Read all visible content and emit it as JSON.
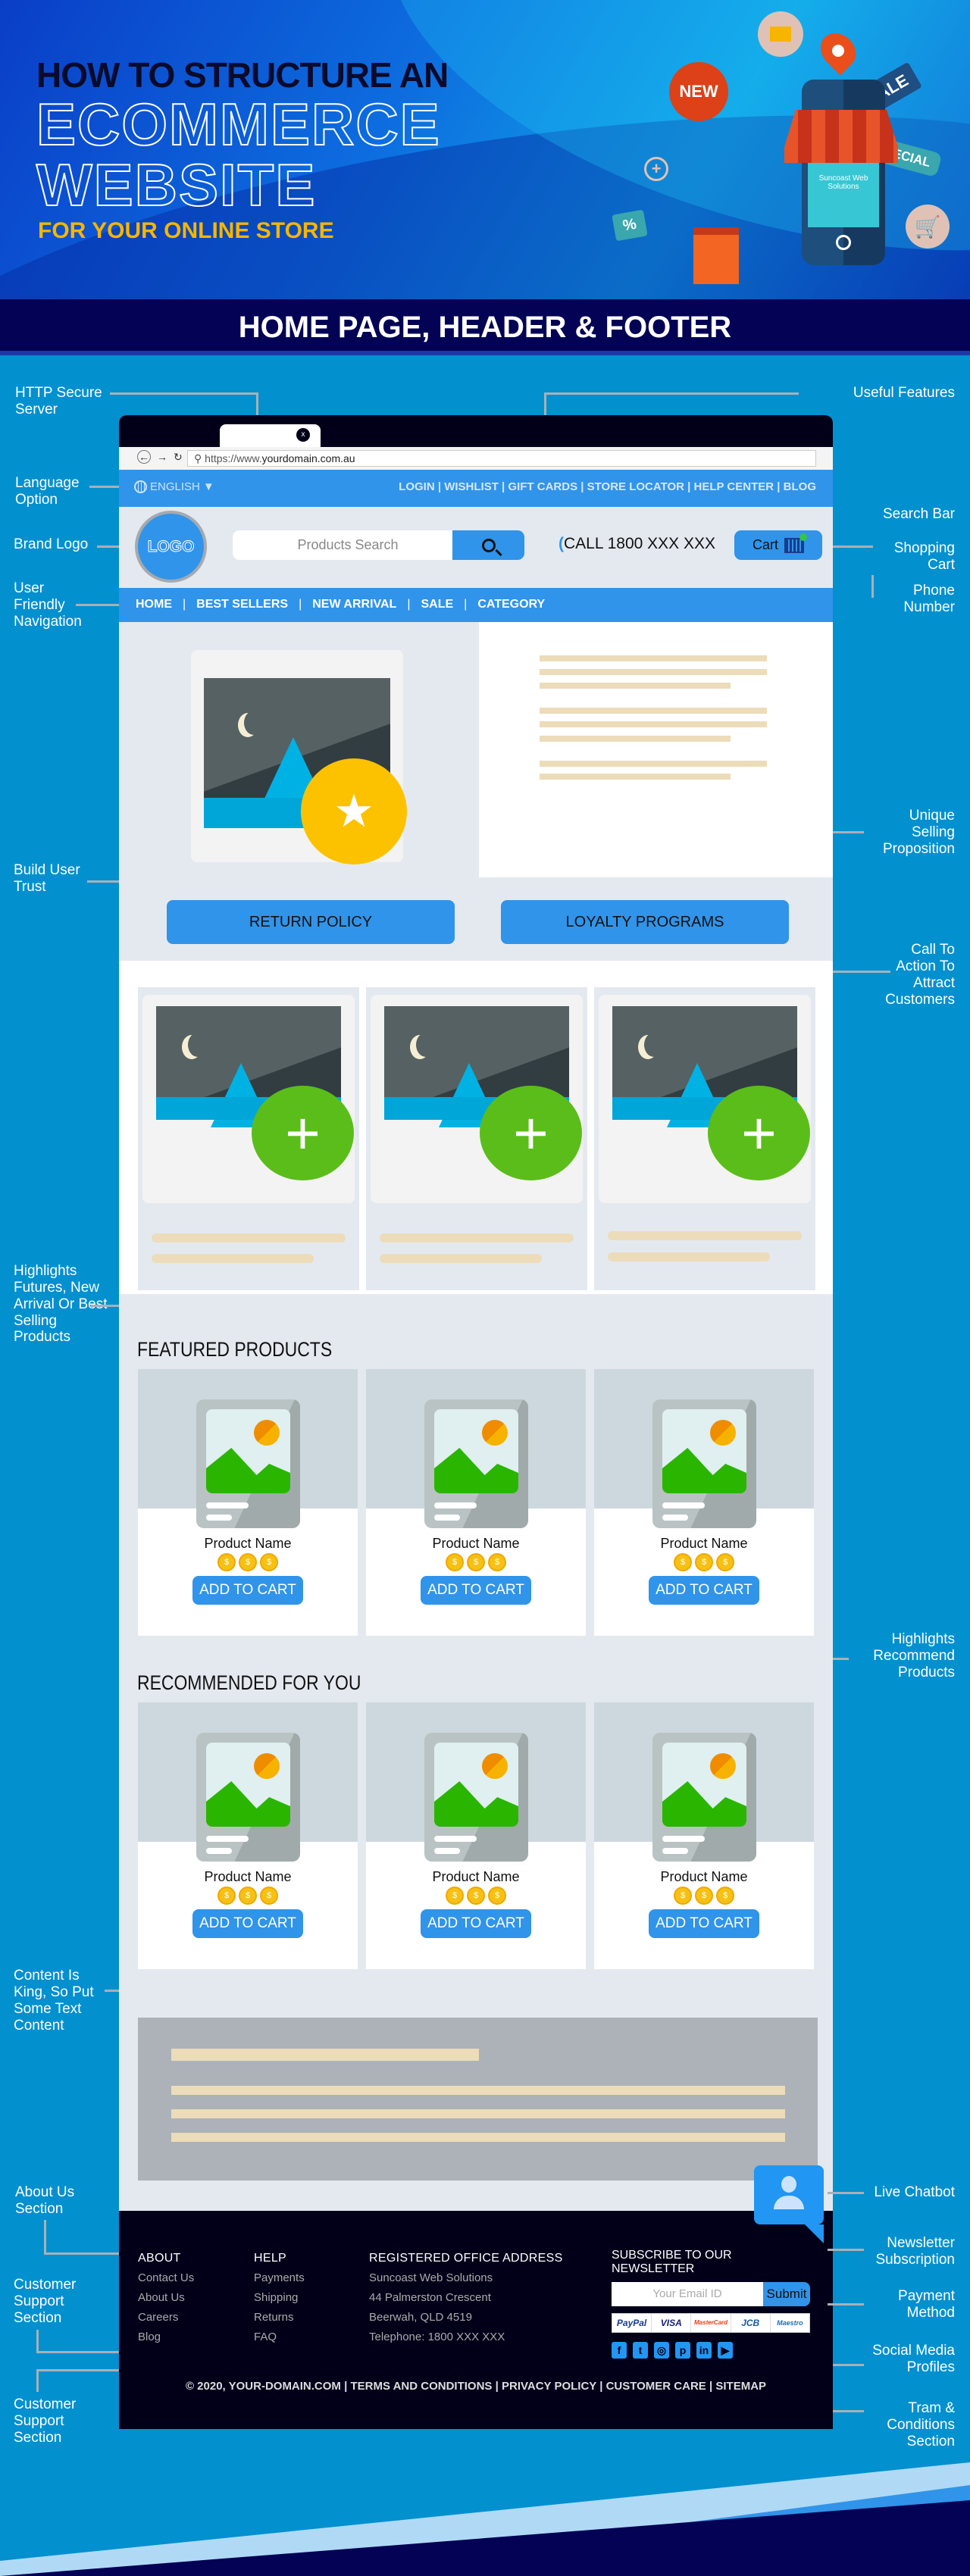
{
  "hero": {
    "line1": "HOW TO STRUCTURE AN",
    "line2": "ECOMMERCE",
    "line3": "WEBSITE",
    "line4": "FOR YOUR ONLINE STORE",
    "badges": {
      "new": "NEW",
      "sale": "SALE",
      "special": "SPECIAL",
      "percent": "%"
    },
    "phone_brand": "Suncoast Web Solutions"
  },
  "section_title": "HOME PAGE, HEADER & FOOTER",
  "annotations": {
    "http": "HTTP Secure Server",
    "useful": "Useful Features",
    "language": "Language Option",
    "search_bar": "Search Bar",
    "brand_logo": "Brand Logo",
    "shopping_cart": "Shopping Cart",
    "user_nav": "User Friendly Navigation",
    "phone": "Phone Number",
    "usp": "Unique Selling Proposition",
    "trust": "Build User Trust",
    "cta": "Call To Action To Attract Customers",
    "highlights": "Highlights Futures, New Arrival Or Best Selling Products",
    "recommend": "Highlights Recommend Products",
    "content": "Content Is King, So Put Some Text Content",
    "chatbot": "Live Chatbot",
    "about": "About Us Section",
    "newsletter": "Newsletter Subscription",
    "support1": "Customer Support Section",
    "payment": "Payment Method",
    "social": "Social Media Profiles",
    "support2": "Customer Support Section",
    "terms": "Tram & Conditions Section"
  },
  "browser": {
    "tab_close": "x",
    "url_prefix": "https://www.",
    "url_domain": "yourdomain.com.au"
  },
  "topbar": {
    "language": "ENGLISH",
    "utility_links": [
      "LOGIN",
      "WISHLIST",
      "GIFT CARDS",
      "STORE LOCATOR",
      "HELP CENTER",
      "BLOG"
    ]
  },
  "header": {
    "logo": "LOGO",
    "search_placeholder": "Products Search",
    "call": "CALL 1800 XXX XXX",
    "cart": "Cart"
  },
  "nav": [
    "HOME",
    "BEST SELLERS",
    "NEW ARRIVAL",
    "SALE",
    "CATEGORY"
  ],
  "trust_buttons": [
    "RETURN POLICY",
    "LOYALTY PROGRAMS"
  ],
  "featured": {
    "title": "FEATURED PRODUCTS",
    "products": [
      {
        "name": "Product Name",
        "button": "ADD TO CART"
      },
      {
        "name": "Product Name",
        "button": "ADD TO CART"
      },
      {
        "name": "Product Name",
        "button": "ADD TO CART"
      }
    ]
  },
  "recommended": {
    "title": "RECOMMENDED FOR YOU",
    "products": [
      {
        "name": "Product Name",
        "button": "ADD TO CART"
      },
      {
        "name": "Product Name",
        "button": "ADD TO CART"
      },
      {
        "name": "Product Name",
        "button": "ADD TO CART"
      }
    ]
  },
  "footer": {
    "about": {
      "title": "ABOUT",
      "links": [
        "Contact Us",
        "About Us",
        "Careers",
        "Blog"
      ]
    },
    "help": {
      "title": "HELP",
      "links": [
        "Payments",
        "Shipping",
        "Returns",
        "FAQ"
      ]
    },
    "office": {
      "title": "REGISTERED OFFICE ADDRESS",
      "lines": [
        "Suncoast Web Solutions",
        "44 Palmerston Crescent",
        "Beerwah, QLD 4519",
        "Telephone: 1800 XXX XXX"
      ]
    },
    "newsletter": {
      "title": "SUBSCRIBE TO OUR NEWSLETTER",
      "placeholder": "Your Email ID",
      "button": "Submit"
    },
    "payments": [
      "PayPal",
      "VISA",
      "MasterCard",
      "JCB",
      "Maestro"
    ],
    "social": [
      "facebook",
      "twitter",
      "instagram",
      "pinterest",
      "linkedin",
      "youtube"
    ],
    "social_glyphs": [
      "f",
      "t",
      "◎",
      "p",
      "in",
      "▶"
    ],
    "copyright": "© 2020, YOUR-DOMAIN.COM",
    "bottom_links": [
      "TERMS AND CONDITIONS",
      "PRIVACY POLICY",
      "CUSTOMER CARE",
      "SITEMAP"
    ]
  },
  "colors": {
    "accent": "#3094ea",
    "dark": "#020019",
    "page_bg": "#0290cf",
    "navy": "#030255",
    "gold": "#f7b500"
  }
}
